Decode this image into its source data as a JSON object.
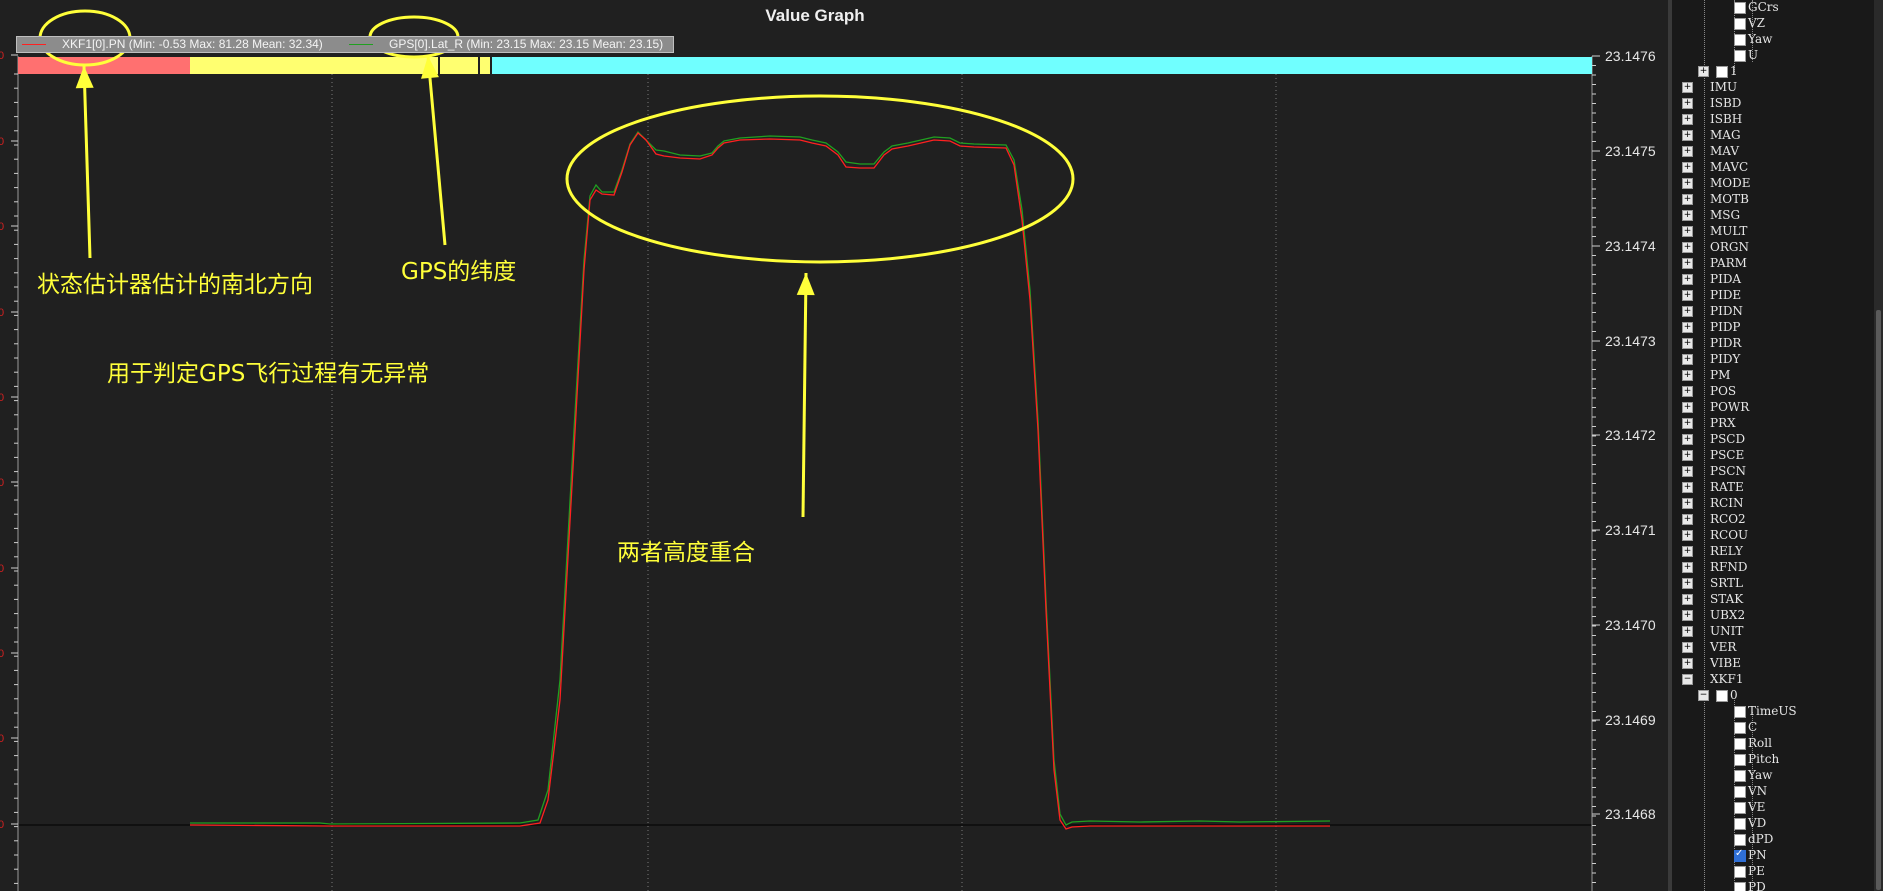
{
  "window": {
    "title": "Value Graph"
  },
  "legend": [
    {
      "label": "XKF1[0].PN",
      "stats": "(Min: -0.53 Max: 81.28 Mean: 32.34)",
      "color": "#ff2020"
    },
    {
      "label": "GPS[0].Lat_R",
      "stats": "(Min: 23.15 Max: 23.15 Mean: 23.15)",
      "color": "#20a020"
    }
  ],
  "mode_bar_colors": [
    "#ff7070",
    "#ffff70",
    "#70ffff"
  ],
  "right_axis": {
    "ticks": [
      "23.1476",
      "23.1475",
      "23.1474",
      "23.1473",
      "23.1472",
      "23.1471",
      "23.1470",
      "23.1469",
      "23.1468"
    ]
  },
  "annotations": {
    "pn_label": "状态估计器估计的南北方向",
    "gps_label": "GPS的纬度",
    "purpose": "用于判定GPS飞行过程有无异常",
    "overlap": "两者高度重合",
    "color": "#ffff3a"
  },
  "tree": {
    "top_fields": [
      "GCrs",
      "VZ",
      "Yaw",
      "U"
    ],
    "instance_1": "1",
    "groups": [
      "IMU",
      "ISBD",
      "ISBH",
      "MAG",
      "MAV",
      "MAVC",
      "MODE",
      "MOTB",
      "MSG",
      "MULT",
      "ORGN",
      "PARM",
      "PIDA",
      "PIDE",
      "PIDN",
      "PIDP",
      "PIDR",
      "PIDY",
      "PM",
      "POS",
      "POWR",
      "PRX",
      "PSCD",
      "PSCE",
      "PSCN",
      "RATE",
      "RCIN",
      "RCO2",
      "RCOU",
      "RELY",
      "RFND",
      "SRTL",
      "STAK",
      "UBX2",
      "UNIT",
      "VER",
      "VIBE",
      "XKF1"
    ],
    "xkf1_instance": "0",
    "xkf1_fields": [
      "TimeUS",
      "C",
      "Roll",
      "Pitch",
      "Yaw",
      "VN",
      "VE",
      "VD",
      "dPD",
      "PN",
      "PE",
      "PD"
    ],
    "checked_field": "PN"
  }
}
